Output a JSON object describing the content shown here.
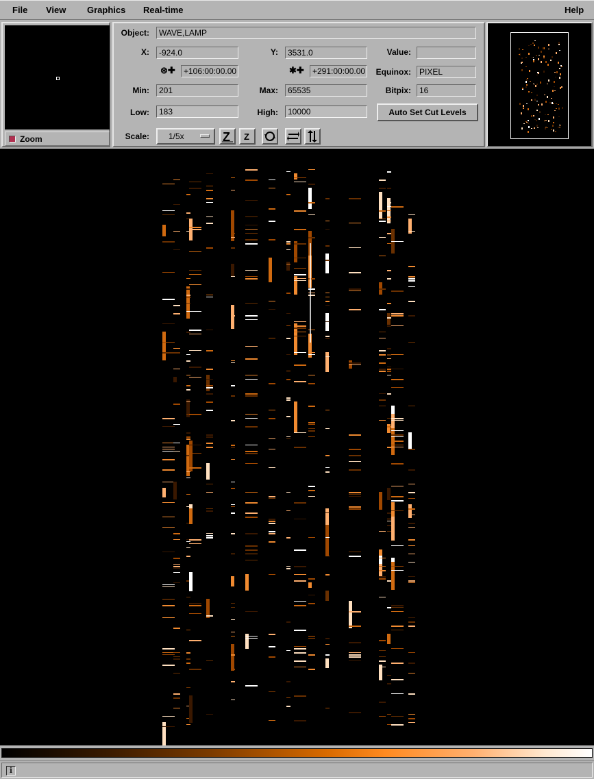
{
  "menu": {
    "file": "File",
    "view": "View",
    "graphics": "Graphics",
    "realtime": "Real-time",
    "help": "Help"
  },
  "zoom": {
    "label": "Zoom"
  },
  "info": {
    "object_label": "Object:",
    "object_value": "WAVE,LAMP",
    "x_label": "X:",
    "x_value": "-924.0",
    "y_label": "Y:",
    "y_value": "3531.0",
    "value_label": "Value:",
    "value_value": "",
    "ra_value": "+106:00:00.00",
    "dec_value": "+291:00:00.00",
    "equinox_label": "Equinox:",
    "equinox_value": "PIXEL",
    "min_label": "Min:",
    "min_value": "201",
    "max_label": "Max:",
    "max_value": "65535",
    "bitpix_label": "Bitpix:",
    "bitpix_value": "16",
    "low_label": "Low:",
    "low_value": "183",
    "high_label": "High:",
    "high_value": "10000",
    "auto_cut_label": "Auto Set Cut Levels",
    "scale_label": "Scale:",
    "scale_value": "1/5x"
  },
  "toolbar_icons": [
    "zoom-fit-icon",
    "zoom-z-icon",
    "rotate-icon",
    "flip-x-icon",
    "flip-y-icon"
  ],
  "colors": {
    "background": "#b4b4b4",
    "image_bg": "#000000",
    "accent": "#ff8a20"
  },
  "status": {
    "icon": "i"
  }
}
